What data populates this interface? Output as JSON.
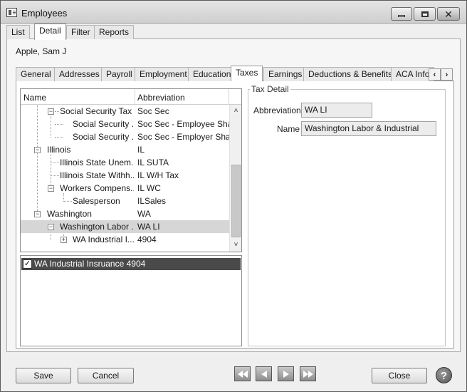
{
  "window": {
    "title": "Employees"
  },
  "top_tabs": [
    {
      "label": "List"
    },
    {
      "label": "Detail"
    },
    {
      "label": "Filter"
    },
    {
      "label": "Reports"
    }
  ],
  "employee_name": "Apple, Sam J",
  "detail_tabs": [
    {
      "label": "General"
    },
    {
      "label": "Addresses"
    },
    {
      "label": "Payroll"
    },
    {
      "label": "Employment"
    },
    {
      "label": "Education"
    },
    {
      "label": "Taxes"
    },
    {
      "label": "Earnings"
    },
    {
      "label": "Deductions & Benefits"
    },
    {
      "label": "ACA Info"
    }
  ],
  "tree": {
    "header": {
      "name": "Name",
      "abbreviation": "Abbreviation"
    },
    "rows": [
      {
        "name": "Social Security Tax",
        "abbr": "Soc Sec"
      },
      {
        "name": "Social Security ...",
        "abbr": "Soc Sec - Employee Share"
      },
      {
        "name": "Social Security ...",
        "abbr": "Soc Sec - Employer Share"
      },
      {
        "name": "Illinois",
        "abbr": "IL"
      },
      {
        "name": "Illinois State Unem...",
        "abbr": "IL SUTA"
      },
      {
        "name": "Illinois State Withh...",
        "abbr": "IL W/H Tax"
      },
      {
        "name": "Workers Compens...",
        "abbr": "IL WC"
      },
      {
        "name": "Salesperson",
        "abbr": "ILSales"
      },
      {
        "name": "Washington",
        "abbr": "WA"
      },
      {
        "name": "Washington Labor ...",
        "abbr": "WA LI"
      },
      {
        "name": "WA Industrial I...",
        "abbr": "4904"
      }
    ]
  },
  "checklist": [
    {
      "label": "WA Industrial Insruance 4904",
      "checked": true
    }
  ],
  "tax_detail": {
    "title": "Tax Detail",
    "abbreviation_label": "Abbreviation",
    "abbreviation_value": "WA LI",
    "name_label": "Name",
    "name_value": "Washington Labor & Industrial"
  },
  "buttons": {
    "save": "Save",
    "cancel": "Cancel",
    "close": "Close",
    "help": "?"
  },
  "icons": {
    "minimize": "minimize-icon",
    "maximize": "maximize-icon",
    "close": "close-icon",
    "first": "first-record-icon",
    "previous": "previous-record-icon",
    "next": "next-record-icon",
    "last": "last-record-icon"
  }
}
